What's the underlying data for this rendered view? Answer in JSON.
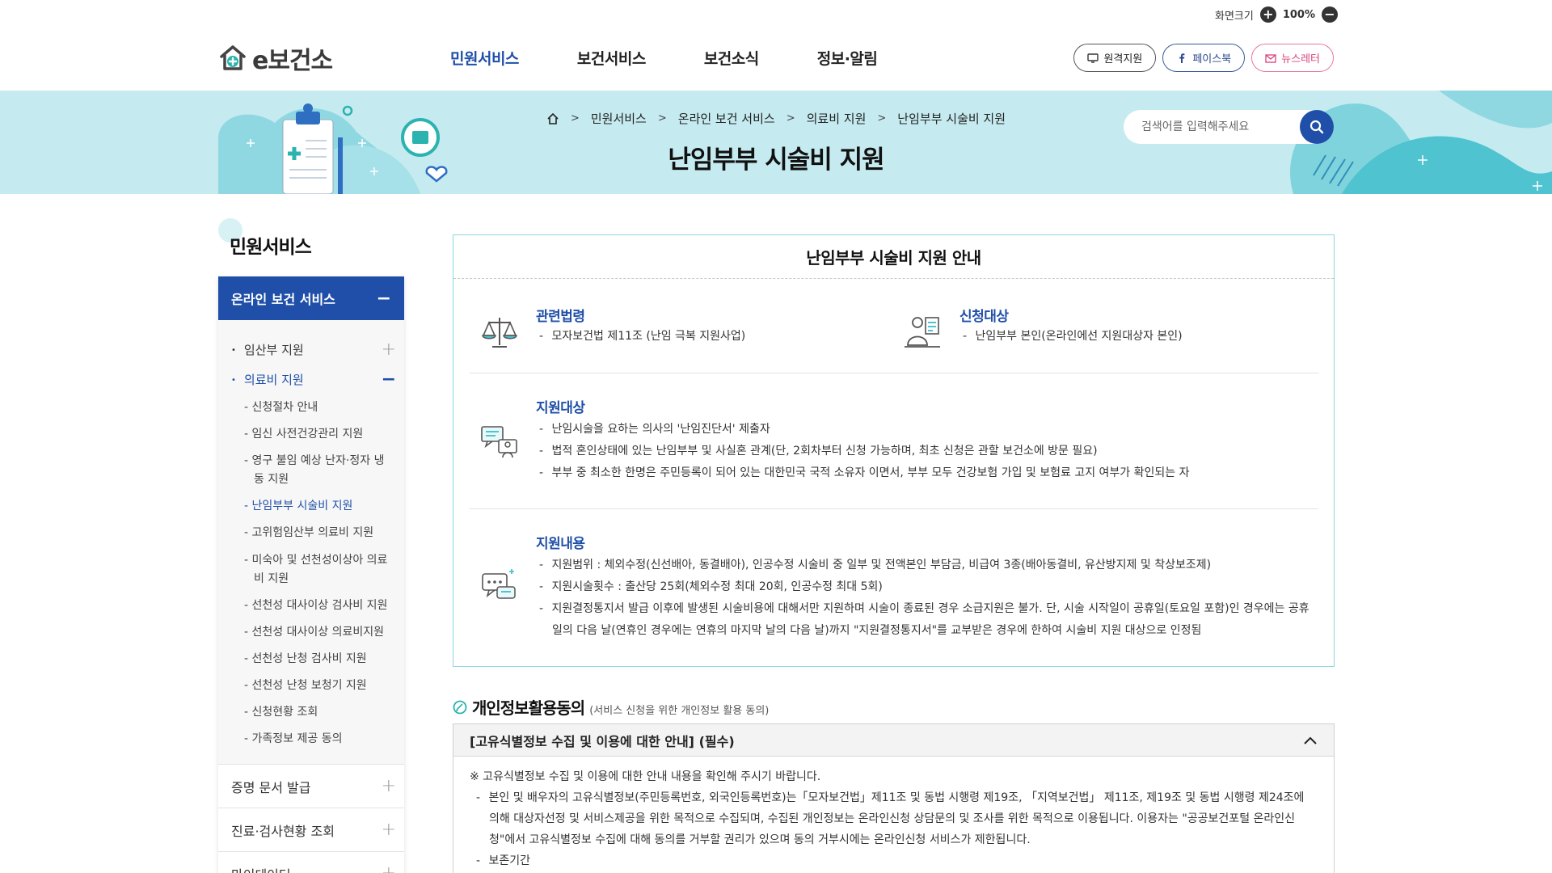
{
  "zoom": {
    "label": "화면크기",
    "value": "100%",
    "plus": "+",
    "minus": "−"
  },
  "logo": {
    "text": "e보건소"
  },
  "gnb": [
    {
      "label": "민원서비스",
      "active": true
    },
    {
      "label": "보건서비스",
      "active": false
    },
    {
      "label": "보건소식",
      "active": false
    },
    {
      "label": "정보·알림",
      "active": false
    }
  ],
  "util": {
    "remote": "원격지원",
    "facebook": "페이스북",
    "newsletter": "뉴스레터"
  },
  "banner": {
    "breadcrumb": [
      "민원서비스",
      "온라인 보건 서비스",
      "의료비 지원",
      "난임부부 시술비 지원"
    ],
    "sep": ">",
    "title": "난임부부 시술비 지원",
    "search_placeholder": "검색어를 입력해주세요"
  },
  "sidebar": {
    "title": "민원서비스",
    "open_group": "온라인 보건 서비스",
    "minus": "−",
    "plus": "+",
    "depth2": [
      {
        "label": "임산부 지원",
        "active": false
      },
      {
        "label": "의료비 지원",
        "active": true
      }
    ],
    "depth3": [
      {
        "label": "신청절차 안내",
        "active": false
      },
      {
        "label": "임신 사전건강관리 지원",
        "active": false
      },
      {
        "label": "영구 불임 예상 난자·정자 냉동 지원",
        "active": false
      },
      {
        "label": "난임부부 시술비 지원",
        "active": true
      },
      {
        "label": "고위험임산부 의료비 지원",
        "active": false
      },
      {
        "label": "미숙아 및 선천성이상아 의료비 지원",
        "active": false
      },
      {
        "label": "선천성 대사이상 검사비 지원",
        "active": false
      },
      {
        "label": "선천성 대사이상 의료비지원",
        "active": false
      },
      {
        "label": "선천성 난청 검사비 지원",
        "active": false
      },
      {
        "label": "선천성 난청 보청기 지원",
        "active": false
      },
      {
        "label": "신청현황 조회",
        "active": false
      },
      {
        "label": "가족정보 제공 동의",
        "active": false
      }
    ],
    "depth1": [
      "증명 문서 발급",
      "진료·검사현황 조회",
      "마이데이터"
    ]
  },
  "info": {
    "title": "난임부부 시술비 지원 안내",
    "law": {
      "heading": "관련법령",
      "items": [
        "모자보건법 제11조 (난임 극복 지원사업)"
      ]
    },
    "applicant": {
      "heading": "신청대상",
      "items": [
        "난임부부 본인(온라인에선 지원대상자 본인)"
      ]
    },
    "target": {
      "heading": "지원대상",
      "items": [
        "난임시술을 요하는 의사의 '난임진단서' 제출자",
        "법적 혼인상태에 있는 난임부부 및 사실혼 관계(단, 2회차부터 신청 가능하며, 최초 신청은 관할 보건소에 방문 필요)",
        "부부 중 최소한 한명은 주민등록이 되어 있는 대한민국 국적 소유자 이면서, 부부 모두 건강보험 가입 및 보험료 고지 여부가 확인되는 자"
      ]
    },
    "content": {
      "heading": "지원내용",
      "items": [
        "지원범위 : 체외수정(신선배아, 동결배아), 인공수정 시술비 중 일부 및 전액본인 부담금, 비급여 3종(배아동결비, 유산방지제 및 착상보조제)",
        "지원시술횟수 : 출산당 25회(체외수정 최대 20회, 인공수정 최대 5회)",
        "지원결정통지서 발급 이후에 발생된 시술비용에 대해서만 지원하며 시술이 종료된 경우 소급지원은 불가. 단, 시술 시작일이 공휴일(토요일 포함)인 경우에는 공휴일의 다음 날(연휴인 경우에는 연휴의 마지막 날의 다음 날)까지 \"지원결정통지서\"를 교부받은 경우에 한하여 시술비 지원 대상으로 인정됨"
      ]
    }
  },
  "consent": {
    "title": "개인정보활용동의",
    "subtitle": "(서비스 신청을 위한 개인정보 활용 동의)",
    "bar": "[고유식별정보 수집 및 이용에 대한 안내] (필수)",
    "notice": "※ 고유식별정보 수집 및 이용에 대한 안내 내용을 확인해 주시기 바랍니다.",
    "items": [
      "본인 및 배우자의 고유식별정보(주민등록번호, 외국인등록번호)는「모자보건법」제11조 및 동법 시행령 제19조, 「지역보건법」 제11조, 제19조 및 동법 시행령 제24조에 의해 대상자선정 및 서비스제공을 위한 목적으로 수집되며, 수집된 개인정보는 온라인신청 상담문의 및 조사를 위한 목적으로 이용됩니다. 이용자는 \"공공보건포털 온라인신청\"에서 고유식별정보 수집에 대해 동의를 거부할 권리가 있으며 동의 거부시에는 온라인신청 서비스가 제한됩니다.",
      "보존기간"
    ]
  },
  "colors": {
    "primary": "#1f4fa8",
    "banner": "#c5ebf0",
    "teal": "#4fc3cf",
    "box_border": "#8fd5de"
  }
}
